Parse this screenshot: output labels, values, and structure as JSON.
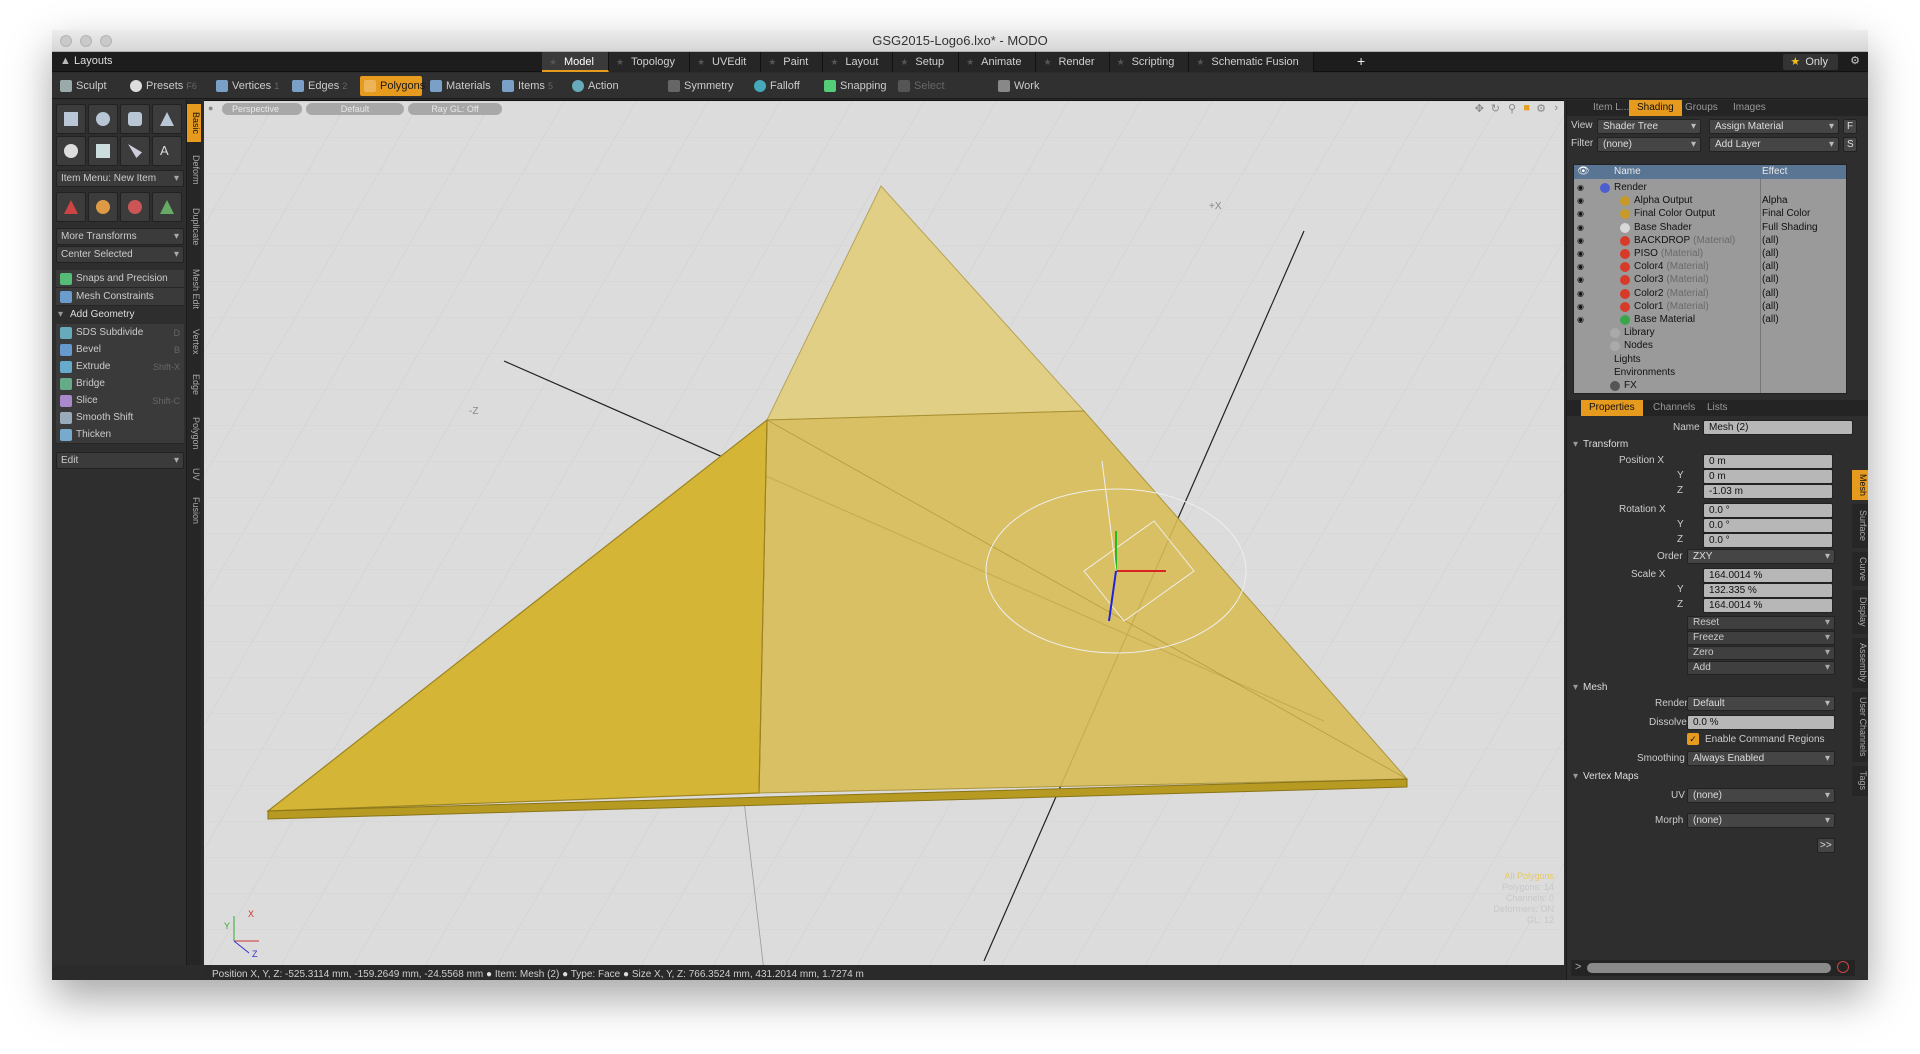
{
  "window": {
    "title": "GSG2015-Logo6.lxo* - MODO"
  },
  "layoutbar": {
    "label": "Layouts",
    "tabs": [
      "Model",
      "Topology",
      "UVEdit",
      "Paint",
      "Layout",
      "Setup",
      "Animate",
      "Render",
      "Scripting",
      "Schematic Fusion"
    ],
    "active_tab": "Model",
    "only_label": "Only"
  },
  "toolbar": {
    "sculpt": "Sculpt",
    "presets": "Presets",
    "presets_key": "F6",
    "vertices": "Vertices",
    "vertices_key": "1",
    "edges": "Edges",
    "edges_key": "2",
    "polygons": "Polygons",
    "materials": "Materials",
    "items": "Items",
    "items_key": "5",
    "action_center": "Action Center",
    "symmetry": "Symmetry",
    "falloff": "Falloff",
    "snapping": "Snapping",
    "select_through": "Select Through",
    "work_plane": "Work Plane"
  },
  "left": {
    "vtabs": [
      "Basic",
      "Deform",
      "Duplicate",
      "Mesh Edit",
      "Vertex",
      "Edge",
      "Polygon",
      "UV",
      "Fusion"
    ],
    "item_menu": "Item Menu: New Item",
    "more_transforms": "More Transforms",
    "center_selected": "Center Selected",
    "snaps": "Snaps and Precision",
    "mesh_constraints": "Mesh Constraints",
    "add_geometry": "Add Geometry",
    "tools": [
      {
        "label": "SDS Subdivide",
        "key": "D"
      },
      {
        "label": "Bevel",
        "key": "B"
      },
      {
        "label": "Extrude",
        "key": "Shift-X"
      },
      {
        "label": "Bridge",
        "key": ""
      },
      {
        "label": "Slice",
        "key": "Shift-C"
      },
      {
        "label": "Smooth Shift",
        "key": ""
      },
      {
        "label": "Thicken",
        "key": ""
      }
    ],
    "edit": "Edit"
  },
  "viewport": {
    "perspective": "Perspective",
    "default": "Default",
    "raygl": "Ray GL: Off",
    "axis_x": "+X",
    "axis_z": "-Z",
    "gizmo": {
      "x": "X",
      "y": "Y",
      "z": "Z"
    },
    "info_lines": [
      "All Polygons",
      "Polygons: 14",
      "Channels: 0",
      "Deformers: ON",
      "GL: 12"
    ]
  },
  "statusbar": {
    "position": "Position X, Y, Z:   -525.3114 mm, -159.2649 mm, -24.5568 mm",
    "item": "Item:   Mesh (2)",
    "type": "Type:   Face",
    "size": "Size X, Y, Z:   766.3524 mm, 431.2014 mm, 1.7274 m"
  },
  "shader_panel": {
    "tabs": [
      "Item L...",
      "Shading",
      "Groups",
      "Images"
    ],
    "active_tab": "Shading",
    "view_label": "View",
    "view_value": "Shader Tree",
    "assign_material": "Assign Material",
    "assign_key": "F",
    "filter_label": "Filter",
    "filter_value": "(none)",
    "add_layer": "Add Layer",
    "add_layer_key": "S",
    "col_name": "Name",
    "col_effect": "Effect",
    "rows": [
      {
        "name": "Render",
        "sub": "",
        "effect": "",
        "indent": 0,
        "color": "#4b5fd1"
      },
      {
        "name": "Alpha Output",
        "sub": "",
        "effect": "Alpha",
        "indent": 2,
        "color": "#c79a2a"
      },
      {
        "name": "Final Color Output",
        "sub": "",
        "effect": "Final Color",
        "indent": 2,
        "color": "#c79a2a"
      },
      {
        "name": "Base Shader",
        "sub": "",
        "effect": "Full Shading",
        "indent": 2,
        "color": "#d8d8d8"
      },
      {
        "name": "BACKDROP",
        "sub": "(Material)",
        "effect": "(all)",
        "indent": 2,
        "color": "#d83a2a"
      },
      {
        "name": "PISO",
        "sub": "(Material)",
        "effect": "(all)",
        "indent": 2,
        "color": "#d83a2a"
      },
      {
        "name": "Color4",
        "sub": "(Material)",
        "effect": "(all)",
        "indent": 2,
        "color": "#d83a2a"
      },
      {
        "name": "Color3",
        "sub": "(Material)",
        "effect": "(all)",
        "indent": 2,
        "color": "#d83a2a"
      },
      {
        "name": "Color2",
        "sub": "(Material)",
        "effect": "(all)",
        "indent": 2,
        "color": "#d83a2a"
      },
      {
        "name": "Color1",
        "sub": "(Material)",
        "effect": "(all)",
        "indent": 2,
        "color": "#d83a2a"
      },
      {
        "name": "Base Material",
        "sub": "",
        "effect": "(all)",
        "indent": 2,
        "color": "#3aa54a"
      },
      {
        "name": "Library",
        "sub": "",
        "effect": "",
        "indent": 1,
        "color": "#aaaaaa"
      },
      {
        "name": "Nodes",
        "sub": "",
        "effect": "",
        "indent": 1,
        "color": "#aaaaaa"
      },
      {
        "name": "Lights",
        "sub": "",
        "effect": "",
        "indent": 0,
        "color": ""
      },
      {
        "name": "Environments",
        "sub": "",
        "effect": "",
        "indent": 0,
        "color": ""
      },
      {
        "name": "FX",
        "sub": "",
        "effect": "",
        "indent": 1,
        "color": "#555555"
      }
    ]
  },
  "properties": {
    "tabs": [
      "Properties",
      "Channels",
      "Lists"
    ],
    "active_tab": "Properties",
    "name_label": "Name",
    "name_value": "Mesh (2)",
    "transform": "Transform",
    "position_label": "Position X",
    "position": [
      "0 m",
      "0 m",
      "-1.03 m"
    ],
    "rotation_label": "Rotation X",
    "rotation": [
      "0.0 °",
      "0.0 °",
      "0.0 °"
    ],
    "order_label": "Order",
    "order_value": "ZXY",
    "scale_label": "Scale X",
    "scale": [
      "164.0014 %",
      "132.335 %",
      "164.0014 %"
    ],
    "y_label": "Y",
    "z_label": "Z",
    "buttons": [
      "Reset",
      "Freeze",
      "Zero",
      "Add"
    ],
    "mesh": "Mesh",
    "render_label": "Render",
    "render_value": "Default",
    "dissolve_label": "Dissolve",
    "dissolve_value": "0.0 %",
    "enable_cmd_regions": "Enable Command Regions",
    "smoothing_label": "Smoothing",
    "smoothing_value": "Always Enabled",
    "vertex_maps": "Vertex Maps",
    "uv_label": "UV",
    "uv_value": "(none)",
    "morph_label": "Morph",
    "morph_value": "(none)",
    "more": ">>",
    "vtabs": [
      "Mesh",
      "Surface",
      "Curve",
      "Display",
      "Assembly",
      "User Channels",
      "Tags"
    ]
  },
  "colors": {
    "accent": "#e69a1e",
    "mesh_fill": "#d4b536",
    "mesh_edge": "#9c8320"
  }
}
